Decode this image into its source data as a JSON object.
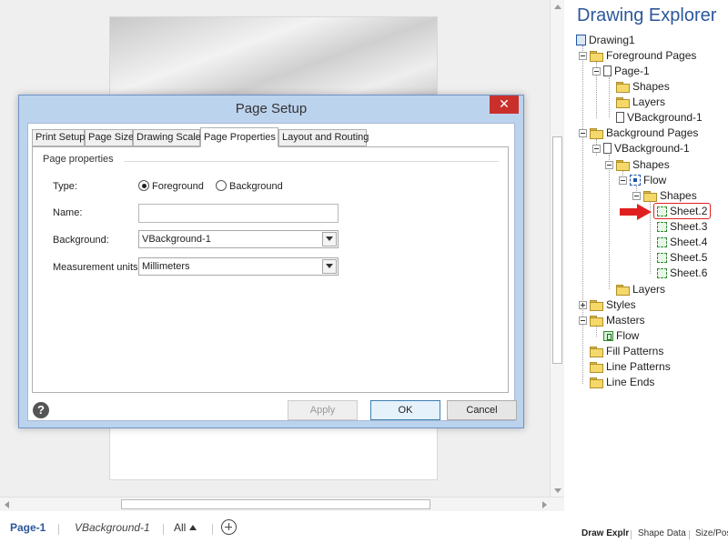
{
  "dialog": {
    "title": "Page Setup",
    "close_glyph": "✕",
    "tabs": [
      "Print Setup",
      "Page Size",
      "Drawing Scale",
      "Page Properties",
      "Layout and Routing"
    ],
    "active_tab": "Page Properties",
    "group_label": "Page properties",
    "type_label": "Type:",
    "type_options": [
      "Foreground",
      "Background"
    ],
    "type_selected": "Foreground",
    "name_label": "Name:",
    "name_value": "",
    "background_label": "Background:",
    "background_value": "VBackground-1",
    "units_label": "Measurement units:",
    "units_value": "Millimeters",
    "help_glyph": "?",
    "buttons": {
      "apply": "Apply",
      "ok": "OK",
      "cancel": "Cancel"
    }
  },
  "page_tabs": {
    "items": [
      "Page-1",
      "VBackground-1"
    ],
    "active": "Page-1",
    "all_label": "All"
  },
  "explorer": {
    "title": "Drawing Explorer",
    "tree": {
      "drawing": "Drawing1",
      "foreground_pages": "Foreground Pages",
      "page1": "Page-1",
      "page1_shapes": "Shapes",
      "page1_layers": "Layers",
      "page1_background": "VBackground-1",
      "background_pages": "Background Pages",
      "vbg": "VBackground-1",
      "vbg_shapes": "Shapes",
      "flow": "Flow",
      "flow_shapes": "Shapes",
      "sheets": [
        "Sheet.2",
        "Sheet.3",
        "Sheet.4",
        "Sheet.5",
        "Sheet.6"
      ],
      "vbg_layers": "Layers",
      "styles": "Styles",
      "masters": "Masters",
      "master_flow": "Flow",
      "fill_patterns": "Fill Patterns",
      "line_patterns": "Line Patterns",
      "line_ends": "Line Ends"
    },
    "selected": "Sheet.2"
  },
  "panel_tabs": [
    "Draw Explr",
    "Shape Data",
    "Size/Pos"
  ],
  "colors": {
    "accent": "#2b579a",
    "dialog_frame": "#bcd3ee",
    "close_button": "#c9302c",
    "highlight": "#e02020"
  }
}
